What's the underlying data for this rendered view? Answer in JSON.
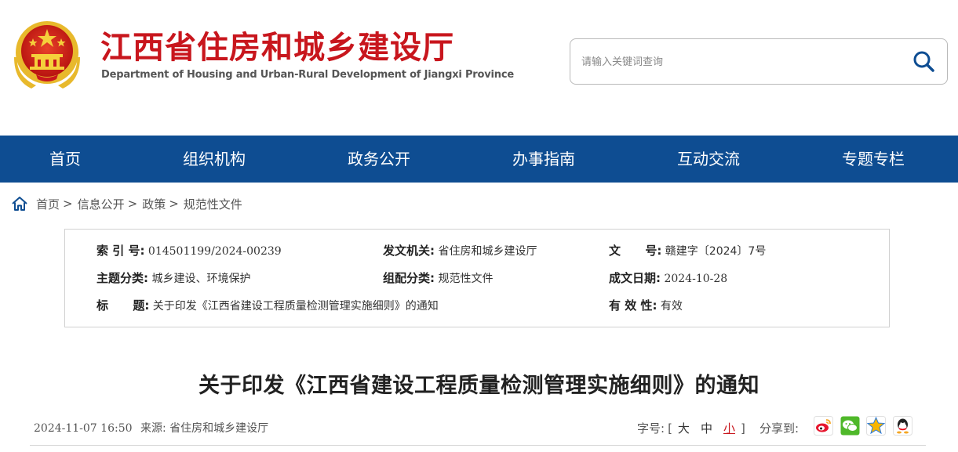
{
  "header": {
    "title": "江西省住房和城乡建设厅",
    "subtitle": "Department of Housing and Urban-Rural Development of Jiangxi Province",
    "search_placeholder": "请输入关键词查询"
  },
  "nav": {
    "items": [
      "首页",
      "组织机构",
      "政务公开",
      "办事指南",
      "互动交流",
      "专题专栏"
    ]
  },
  "breadcrumb": {
    "items": [
      "首页",
      "信息公开",
      "政策",
      "规范性文件"
    ],
    "separator": ">"
  },
  "info": {
    "index_label": "索 引 号:",
    "index_value": "014501199/2024-00239",
    "issuer_label": "发文机关:",
    "issuer_value": "省住房和城乡建设厅",
    "docno_label": "文      号:",
    "docno_value": "赣建字〔2024〕7号",
    "topic_label": "主题分类:",
    "topic_value": "城乡建设、环境保护",
    "category_label": "组配分类:",
    "category_value": "规范性文件",
    "date_label": "成文日期:",
    "date_value": "2024-10-28",
    "title_label": "标      题:",
    "title_value": "关于印发《江西省建设工程质量检测管理实施细则》的通知",
    "validity_label": "有 效 性:",
    "validity_value": "有效"
  },
  "article": {
    "title": "关于印发《江西省建设工程质量检测管理实施细则》的通知",
    "datetime": "2024-11-07 16:50",
    "source_label": "来源:",
    "source_value": "省住房和城乡建设厅",
    "fontsize_label": "字号:",
    "fontsize_open": "[",
    "fontsize_large": "大",
    "fontsize_medium": "中",
    "fontsize_small": "小",
    "fontsize_close": "]",
    "share_label": "分享到:"
  },
  "colors": {
    "brand_red": "#c8161d",
    "nav_blue": "#0e4d92"
  },
  "icons": {
    "emblem": "national-emblem-icon",
    "search": "search-icon",
    "home": "home-icon",
    "share": [
      "weibo-icon",
      "wechat-icon",
      "qzone-icon",
      "qq-icon"
    ]
  }
}
